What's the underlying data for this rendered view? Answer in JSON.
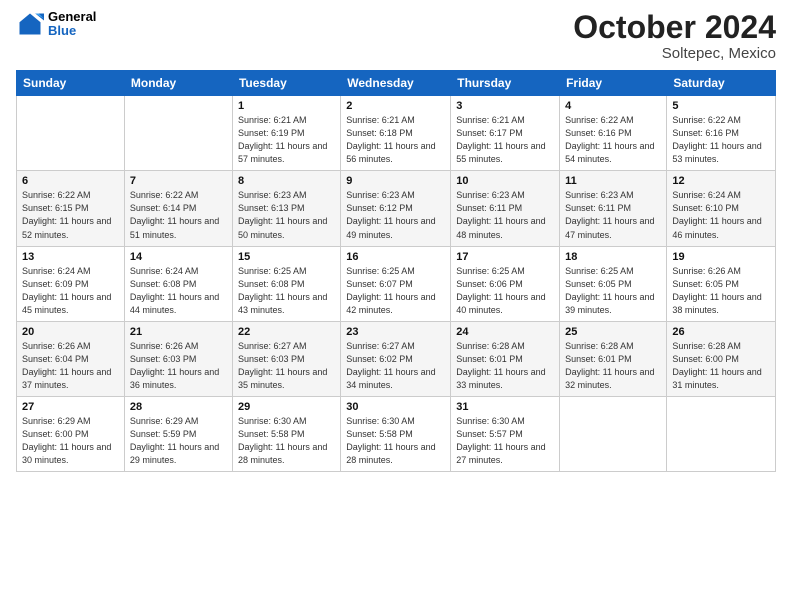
{
  "logo": {
    "general": "General",
    "blue": "Blue"
  },
  "title": {
    "month_year": "October 2024",
    "location": "Soltepec, Mexico"
  },
  "days_of_week": [
    "Sunday",
    "Monday",
    "Tuesday",
    "Wednesday",
    "Thursday",
    "Friday",
    "Saturday"
  ],
  "weeks": [
    [
      {
        "day": "",
        "sunrise": "",
        "sunset": "",
        "daylight": ""
      },
      {
        "day": "",
        "sunrise": "",
        "sunset": "",
        "daylight": ""
      },
      {
        "day": "1",
        "sunrise": "Sunrise: 6:21 AM",
        "sunset": "Sunset: 6:19 PM",
        "daylight": "Daylight: 11 hours and 57 minutes."
      },
      {
        "day": "2",
        "sunrise": "Sunrise: 6:21 AM",
        "sunset": "Sunset: 6:18 PM",
        "daylight": "Daylight: 11 hours and 56 minutes."
      },
      {
        "day": "3",
        "sunrise": "Sunrise: 6:21 AM",
        "sunset": "Sunset: 6:17 PM",
        "daylight": "Daylight: 11 hours and 55 minutes."
      },
      {
        "day": "4",
        "sunrise": "Sunrise: 6:22 AM",
        "sunset": "Sunset: 6:16 PM",
        "daylight": "Daylight: 11 hours and 54 minutes."
      },
      {
        "day": "5",
        "sunrise": "Sunrise: 6:22 AM",
        "sunset": "Sunset: 6:16 PM",
        "daylight": "Daylight: 11 hours and 53 minutes."
      }
    ],
    [
      {
        "day": "6",
        "sunrise": "Sunrise: 6:22 AM",
        "sunset": "Sunset: 6:15 PM",
        "daylight": "Daylight: 11 hours and 52 minutes."
      },
      {
        "day": "7",
        "sunrise": "Sunrise: 6:22 AM",
        "sunset": "Sunset: 6:14 PM",
        "daylight": "Daylight: 11 hours and 51 minutes."
      },
      {
        "day": "8",
        "sunrise": "Sunrise: 6:23 AM",
        "sunset": "Sunset: 6:13 PM",
        "daylight": "Daylight: 11 hours and 50 minutes."
      },
      {
        "day": "9",
        "sunrise": "Sunrise: 6:23 AM",
        "sunset": "Sunset: 6:12 PM",
        "daylight": "Daylight: 11 hours and 49 minutes."
      },
      {
        "day": "10",
        "sunrise": "Sunrise: 6:23 AM",
        "sunset": "Sunset: 6:11 PM",
        "daylight": "Daylight: 11 hours and 48 minutes."
      },
      {
        "day": "11",
        "sunrise": "Sunrise: 6:23 AM",
        "sunset": "Sunset: 6:11 PM",
        "daylight": "Daylight: 11 hours and 47 minutes."
      },
      {
        "day": "12",
        "sunrise": "Sunrise: 6:24 AM",
        "sunset": "Sunset: 6:10 PM",
        "daylight": "Daylight: 11 hours and 46 minutes."
      }
    ],
    [
      {
        "day": "13",
        "sunrise": "Sunrise: 6:24 AM",
        "sunset": "Sunset: 6:09 PM",
        "daylight": "Daylight: 11 hours and 45 minutes."
      },
      {
        "day": "14",
        "sunrise": "Sunrise: 6:24 AM",
        "sunset": "Sunset: 6:08 PM",
        "daylight": "Daylight: 11 hours and 44 minutes."
      },
      {
        "day": "15",
        "sunrise": "Sunrise: 6:25 AM",
        "sunset": "Sunset: 6:08 PM",
        "daylight": "Daylight: 11 hours and 43 minutes."
      },
      {
        "day": "16",
        "sunrise": "Sunrise: 6:25 AM",
        "sunset": "Sunset: 6:07 PM",
        "daylight": "Daylight: 11 hours and 42 minutes."
      },
      {
        "day": "17",
        "sunrise": "Sunrise: 6:25 AM",
        "sunset": "Sunset: 6:06 PM",
        "daylight": "Daylight: 11 hours and 40 minutes."
      },
      {
        "day": "18",
        "sunrise": "Sunrise: 6:25 AM",
        "sunset": "Sunset: 6:05 PM",
        "daylight": "Daylight: 11 hours and 39 minutes."
      },
      {
        "day": "19",
        "sunrise": "Sunrise: 6:26 AM",
        "sunset": "Sunset: 6:05 PM",
        "daylight": "Daylight: 11 hours and 38 minutes."
      }
    ],
    [
      {
        "day": "20",
        "sunrise": "Sunrise: 6:26 AM",
        "sunset": "Sunset: 6:04 PM",
        "daylight": "Daylight: 11 hours and 37 minutes."
      },
      {
        "day": "21",
        "sunrise": "Sunrise: 6:26 AM",
        "sunset": "Sunset: 6:03 PM",
        "daylight": "Daylight: 11 hours and 36 minutes."
      },
      {
        "day": "22",
        "sunrise": "Sunrise: 6:27 AM",
        "sunset": "Sunset: 6:03 PM",
        "daylight": "Daylight: 11 hours and 35 minutes."
      },
      {
        "day": "23",
        "sunrise": "Sunrise: 6:27 AM",
        "sunset": "Sunset: 6:02 PM",
        "daylight": "Daylight: 11 hours and 34 minutes."
      },
      {
        "day": "24",
        "sunrise": "Sunrise: 6:28 AM",
        "sunset": "Sunset: 6:01 PM",
        "daylight": "Daylight: 11 hours and 33 minutes."
      },
      {
        "day": "25",
        "sunrise": "Sunrise: 6:28 AM",
        "sunset": "Sunset: 6:01 PM",
        "daylight": "Daylight: 11 hours and 32 minutes."
      },
      {
        "day": "26",
        "sunrise": "Sunrise: 6:28 AM",
        "sunset": "Sunset: 6:00 PM",
        "daylight": "Daylight: 11 hours and 31 minutes."
      }
    ],
    [
      {
        "day": "27",
        "sunrise": "Sunrise: 6:29 AM",
        "sunset": "Sunset: 6:00 PM",
        "daylight": "Daylight: 11 hours and 30 minutes."
      },
      {
        "day": "28",
        "sunrise": "Sunrise: 6:29 AM",
        "sunset": "Sunset: 5:59 PM",
        "daylight": "Daylight: 11 hours and 29 minutes."
      },
      {
        "day": "29",
        "sunrise": "Sunrise: 6:30 AM",
        "sunset": "Sunset: 5:58 PM",
        "daylight": "Daylight: 11 hours and 28 minutes."
      },
      {
        "day": "30",
        "sunrise": "Sunrise: 6:30 AM",
        "sunset": "Sunset: 5:58 PM",
        "daylight": "Daylight: 11 hours and 28 minutes."
      },
      {
        "day": "31",
        "sunrise": "Sunrise: 6:30 AM",
        "sunset": "Sunset: 5:57 PM",
        "daylight": "Daylight: 11 hours and 27 minutes."
      },
      {
        "day": "",
        "sunrise": "",
        "sunset": "",
        "daylight": ""
      },
      {
        "day": "",
        "sunrise": "",
        "sunset": "",
        "daylight": ""
      }
    ]
  ]
}
